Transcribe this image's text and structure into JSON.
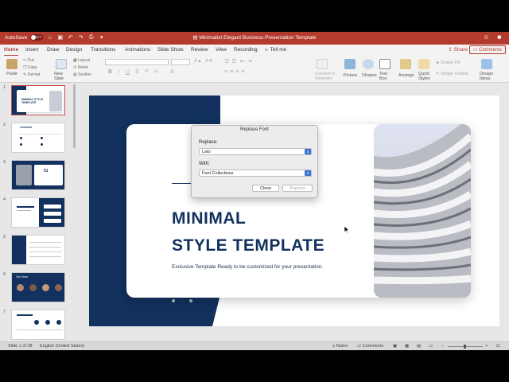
{
  "titlebar": {
    "autosave_label": "AutoSave",
    "autosave_state": "OFF",
    "doc_title": "Minimalist Elegant Business Presentation Template",
    "icons": [
      "home-icon",
      "save-icon",
      "undo-icon",
      "redo-icon",
      "print-icon",
      "customize-icon",
      "person-icon",
      "smiley-icon"
    ]
  },
  "tabs": [
    "Home",
    "Insert",
    "Draw",
    "Design",
    "Transitions",
    "Animations",
    "Slide Show",
    "Review",
    "View",
    "Recording"
  ],
  "tell_me": "Tell me",
  "share_label": "Share",
  "comments_label": "Comments",
  "ribbon": {
    "paste": "Paste",
    "cut": "Cut",
    "copy": "Copy",
    "format": "Format",
    "new_slide": "New Slide",
    "layout": "Layout",
    "reset": "Reset",
    "section": "Section",
    "convert_to_smartart": "Convert to SmartArt",
    "picture": "Picture",
    "shapes": "Shapes",
    "text_box": "Text Box",
    "arrange": "Arrange",
    "quick_styles": "Quick Styles",
    "shape_fill": "Shape Fill",
    "shape_outline": "Shape Outline",
    "design_ideas": "Design Ideas"
  },
  "thumbnails": [
    {
      "number": "1",
      "title": "MINIMAL STYLE TEMPLATE"
    },
    {
      "number": "2",
      "title": "Contents"
    },
    {
      "number": "3",
      "title": "01"
    },
    {
      "number": "4",
      "title": ""
    },
    {
      "number": "5",
      "title": ""
    },
    {
      "number": "6",
      "title": "Our Team"
    },
    {
      "number": "7",
      "title": ""
    }
  ],
  "slide": {
    "title_line1": "MINIMAL",
    "title_line2": "STYLE TEMPLATE",
    "subtitle": "Exclusive Template Ready to be customized for your presentation."
  },
  "dialog": {
    "title": "Replace Font",
    "replace_label": "Replace:",
    "replace_value": "Lato",
    "with_label": "With:",
    "with_value": "Font Collections",
    "close_label": "Close",
    "replace_button": "Replace"
  },
  "statusbar": {
    "slide_info": "Slide 1 of 28",
    "language": "English (United States)",
    "notes": "Notes",
    "comments": "Comments"
  },
  "colors": {
    "accent": "#b33b2e",
    "navy": "#12315e",
    "dialog_arrow": "#3b74d1"
  }
}
